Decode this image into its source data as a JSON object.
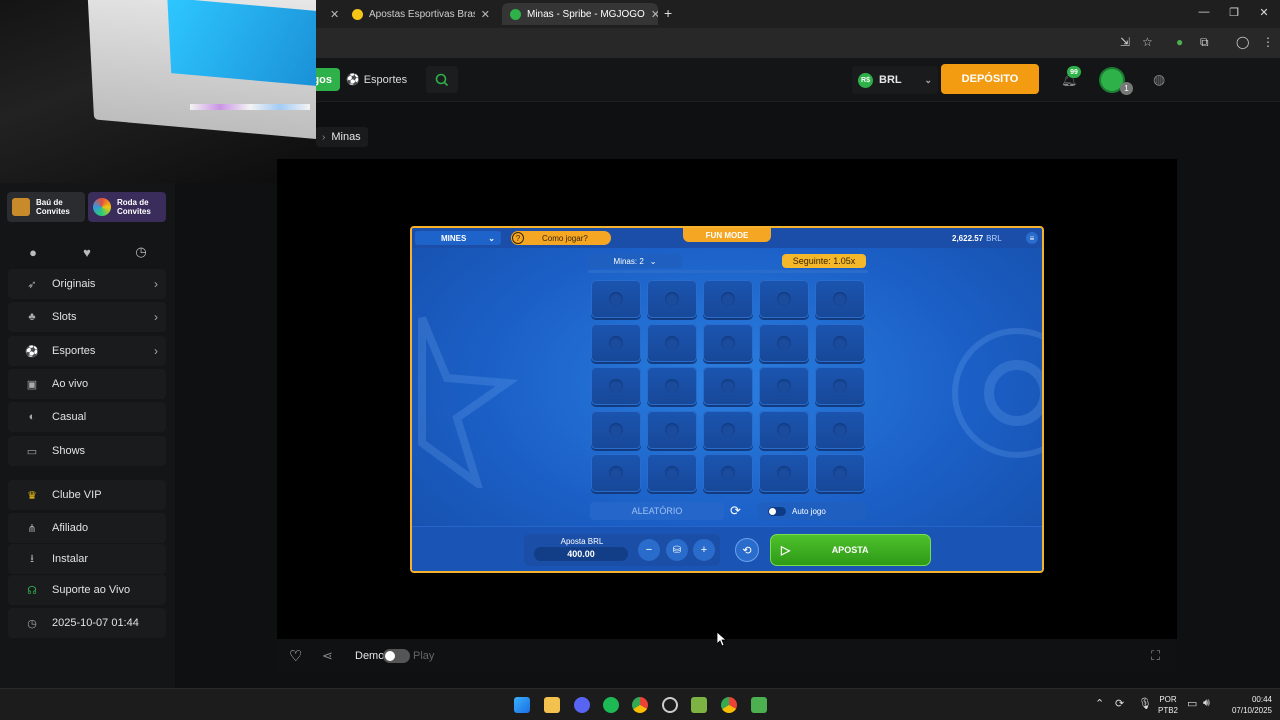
{
  "browser": {
    "tabs": [
      {
        "title": "Apostas Esportivas Brasil - Cas",
        "active": false
      },
      {
        "title": "Minas - Spribe - MGJOGO",
        "active": true
      }
    ],
    "new_tab_symbol": "+"
  },
  "site": {
    "nav_partial": "gos",
    "esportes_label": "Esportes",
    "currency_symbol": "R$",
    "currency": "BRL",
    "deposit_label": "DEPÓSITO",
    "notifications_badge": "99",
    "avatar_badge": "1",
    "accent": "#2fb14a",
    "deposit_color": "#f39c12"
  },
  "sidebar": {
    "promos": [
      {
        "label_line1": "Baú de",
        "label_line2": "Convites"
      },
      {
        "label_line1": "Roda de",
        "label_line2": "Convites"
      }
    ],
    "quick_icons": [
      "fire-icon",
      "heart-icon",
      "history-icon"
    ],
    "items": [
      {
        "label": "Originais",
        "icon": "rocket-icon",
        "chevron": true
      },
      {
        "label": "Slots",
        "icon": "cherry-icon",
        "chevron": true
      },
      {
        "label": "Esportes",
        "icon": "ball-icon",
        "chevron": true
      },
      {
        "label": "Ao vivo",
        "icon": "live-icon",
        "chevron": false
      },
      {
        "label": "Casual",
        "icon": "gamepad-icon",
        "chevron": false
      },
      {
        "label": "Shows",
        "icon": "tv-icon",
        "chevron": false
      },
      {
        "label": "Clube VIP",
        "icon": "crown-icon",
        "chevron": false
      },
      {
        "label": "Afiliado",
        "icon": "share-icon",
        "chevron": false
      },
      {
        "label": "Instalar",
        "icon": "download-icon",
        "chevron": false
      },
      {
        "label": "Suporte ao Vivo",
        "icon": "headset-icon",
        "chevron": false
      },
      {
        "label": "2025-10-07 01:44",
        "icon": "clock-icon",
        "chevron": false
      }
    ]
  },
  "breadcrumb": {
    "current": "Minas"
  },
  "game": {
    "game_select": "MINES",
    "how_to_play": "Como jogar?",
    "fun_mode": "FUN MODE",
    "balance": "2,622.57",
    "balance_currency": "BRL",
    "mines_select": "Minas: 2",
    "next_multiplier": "Seguinte: 1.05x",
    "grid_rows": 5,
    "grid_cols": 5,
    "random_label": "ALEATÓRIO",
    "auto_label": "Auto jogo",
    "bet_label": "Aposta BRL",
    "bet_value": "400.00",
    "minus": "−",
    "plus": "+",
    "bet_button": "APOSTA"
  },
  "player_footer": {
    "demo_label": "Demo",
    "play_label": "Play"
  },
  "taskbar": {
    "lang_line1": "POR",
    "lang_line2": "PTB2",
    "time": "00:44",
    "date": "07/10/2025"
  }
}
